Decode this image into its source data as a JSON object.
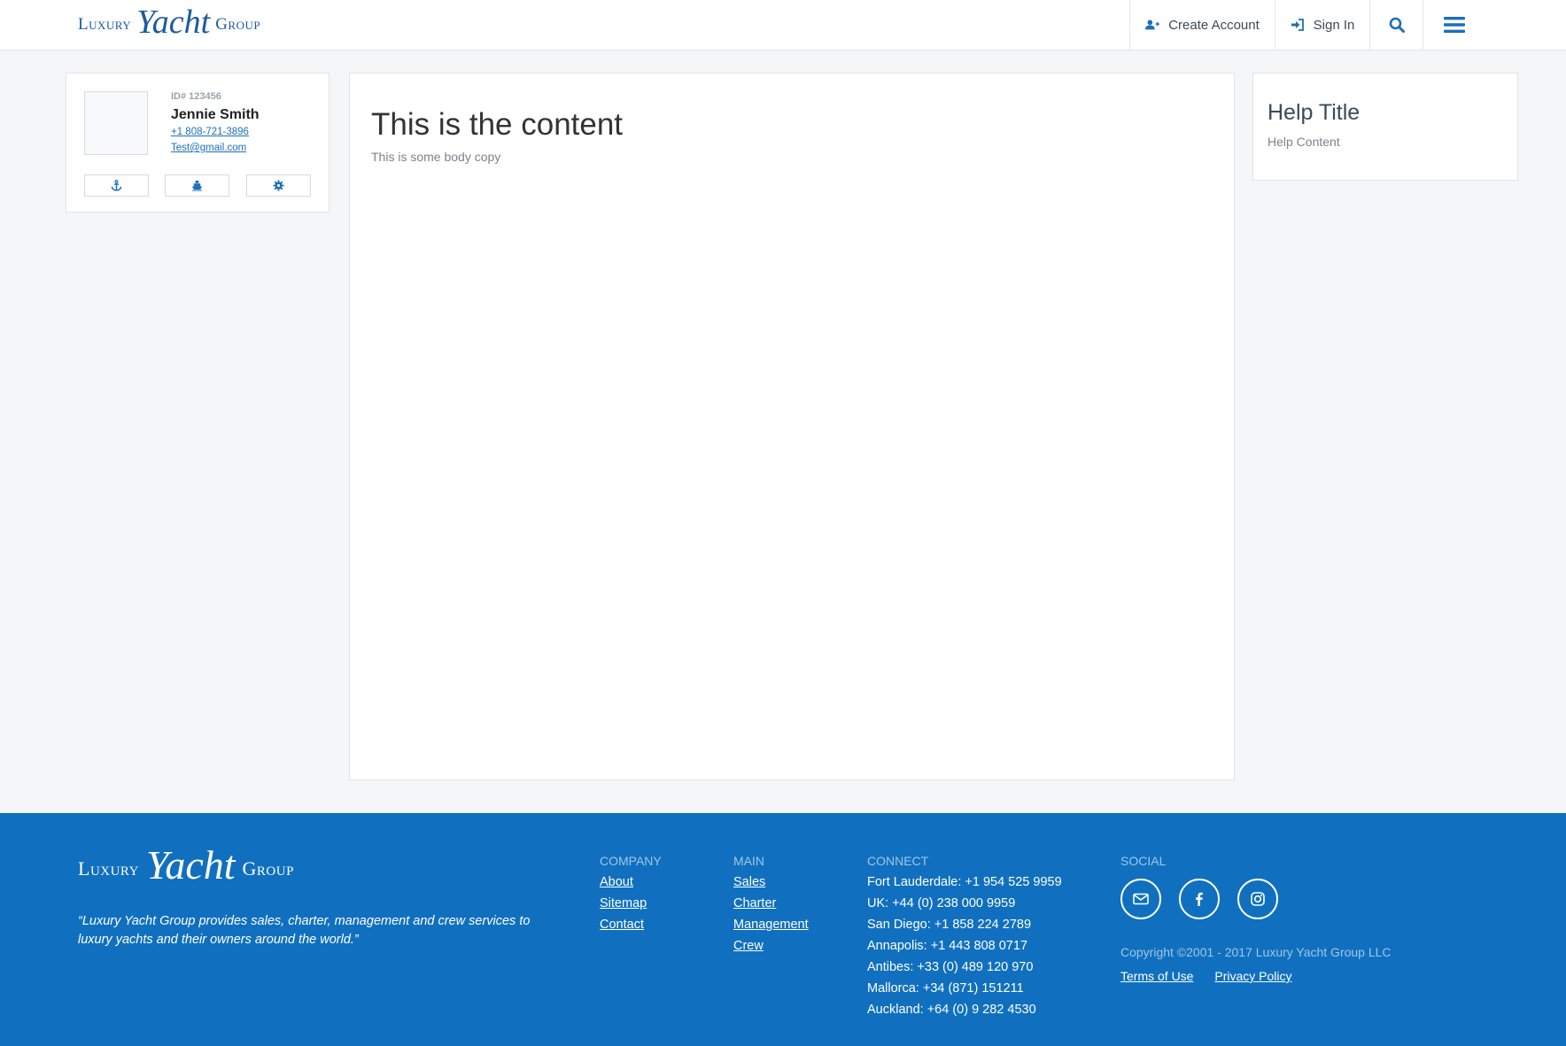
{
  "brand": {
    "word1": "Luxury",
    "word2": "Yacht",
    "word3": "Group"
  },
  "header": {
    "nav": {
      "create_account": "Create Account",
      "sign_in": "Sign In"
    }
  },
  "profile": {
    "id_label": "ID# 123456",
    "name": "Jennie Smith",
    "phone": "+1 808-721-3896",
    "email": "Test@gmail.com"
  },
  "content": {
    "title": "This is the content",
    "body": "This is some body copy"
  },
  "help": {
    "title": "Help Title",
    "body": "Help Content"
  },
  "footer": {
    "quote": "“Luxury Yacht Group provides sales, charter, management and crew services to luxury yachts and their owners around the world.”",
    "company": {
      "heading": "COMPANY",
      "links": [
        "About",
        "Sitemap",
        "Contact"
      ]
    },
    "main": {
      "heading": "MAIN",
      "links": [
        "Sales",
        "Charter",
        "Management",
        "Crew"
      ]
    },
    "connect": {
      "heading": "CONNECT",
      "lines": [
        "Fort Lauderdale: +1 954 525 9959",
        "UK: +44 (0) 238 000 9959",
        "San Diego: +1 858 224 2789",
        "Annapolis: +1 443 808 0717",
        "Antibes: +33 (0) 489 120 970",
        "Mallorca: +34 (871) 151211",
        "Auckland: +64 (0) 9 282 4530"
      ]
    },
    "social": {
      "heading": "SOCIAL"
    },
    "copyright": "Copyright ©2001 - 2017 Luxury Yacht Group LLC",
    "legal": {
      "terms": "Terms of Use",
      "privacy": "Privacy Policy"
    }
  },
  "colors": {
    "brand_blue": "#1070bf",
    "link_blue": "#1c6fb8",
    "page_bg": "#f4f6f8"
  }
}
